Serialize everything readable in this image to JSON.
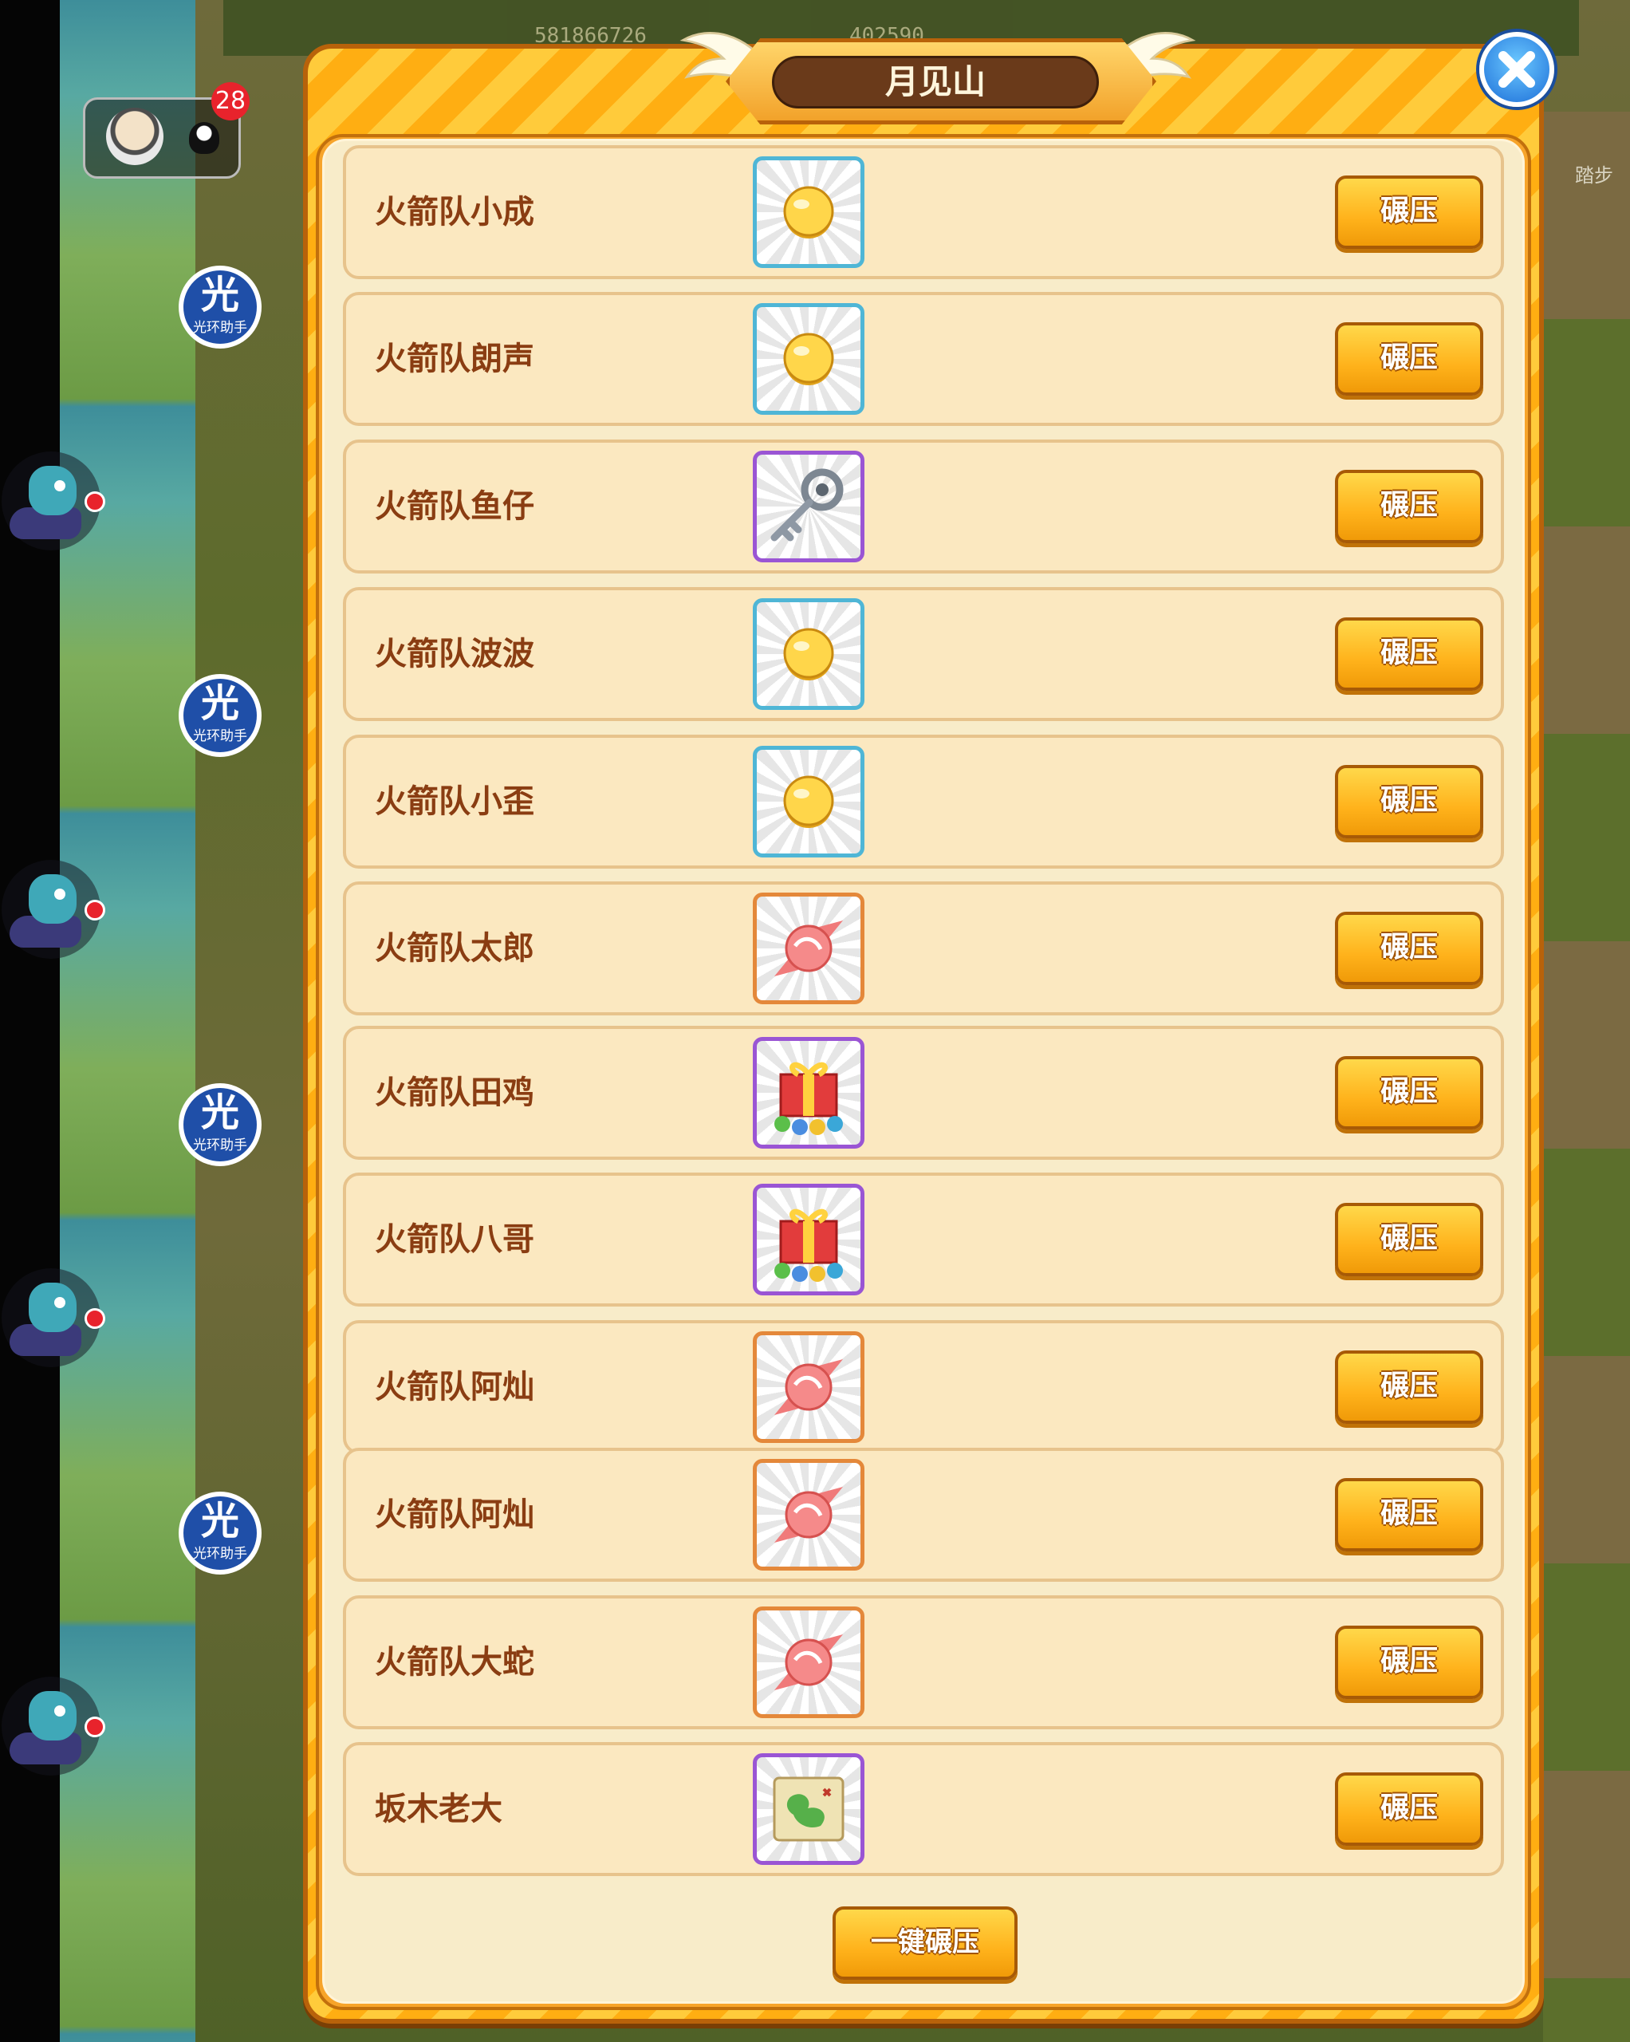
{
  "dialog": {
    "title": "月见山",
    "close_icon": "close-icon",
    "crush_all_label": "一键碾压"
  },
  "hud": {
    "top_gold": "581866726",
    "top_diamond": "402590",
    "notification_count": "28",
    "assistant_label": "光环助手",
    "assistant_glyph": "光",
    "steps_label": "踏步"
  },
  "colors": {
    "panel_orange": "#ffae12",
    "panel_stripe": "#ffcb3b",
    "row_background": "#fbe8c0",
    "name_text": "#8a3d12",
    "button_gold": "#ffb21b",
    "title_plate": "#6a3a1a"
  },
  "rows": [
    {
      "name": "火箭队小成",
      "reward": "coin",
      "frame": "blue",
      "button": "碾压"
    },
    {
      "name": "火箭队朗声",
      "reward": "coin",
      "frame": "blue",
      "button": "碾压"
    },
    {
      "name": "火箭队鱼仔",
      "reward": "key",
      "frame": "purple",
      "button": "碾压"
    },
    {
      "name": "火箭队波波",
      "reward": "coin",
      "frame": "blue",
      "button": "碾压"
    },
    {
      "name": "火箭队小歪",
      "reward": "coin",
      "frame": "blue",
      "button": "碾压"
    },
    {
      "name": "火箭队太郎",
      "reward": "candy",
      "frame": "orange",
      "button": "碾压"
    },
    {
      "name": "火箭队田鸡",
      "reward": "gift-box",
      "frame": "purple",
      "button": "碾压"
    },
    {
      "name": "火箭队八哥",
      "reward": "gift-box",
      "frame": "purple",
      "button": "碾压"
    },
    {
      "name": "火箭队阿灿",
      "reward": "candy",
      "frame": "orange",
      "button": "碾压"
    },
    {
      "name": "火箭队阿灿",
      "reward": "candy",
      "frame": "orange",
      "button": "碾压"
    },
    {
      "name": "火箭队大蛇",
      "reward": "candy",
      "frame": "orange",
      "button": "碾压"
    },
    {
      "name": "坂木老大",
      "reward": "treasure-map",
      "frame": "purple",
      "button": "碾压"
    }
  ]
}
